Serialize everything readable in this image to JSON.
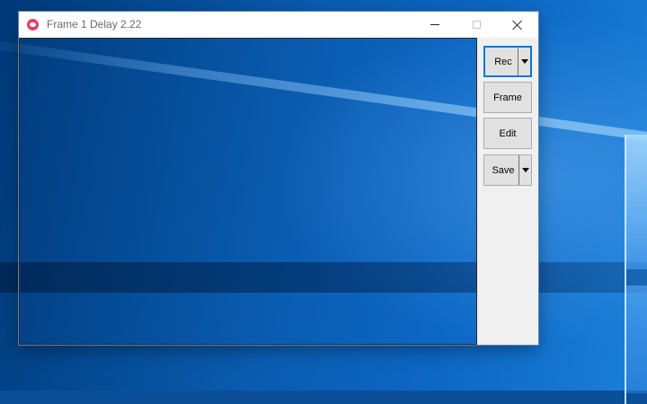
{
  "window": {
    "title": "Frame 1 Delay 2.22",
    "icon": "camera-icon"
  },
  "caption_buttons": {
    "minimize": "minimize-icon",
    "maximize": "maximize-icon",
    "close": "close-icon"
  },
  "toolbar": {
    "rec_label": "Rec",
    "frame_label": "Frame",
    "edit_label": "Edit",
    "save_label": "Save"
  },
  "colors": {
    "accent": "#0078d7",
    "icon": "#e0406a"
  }
}
